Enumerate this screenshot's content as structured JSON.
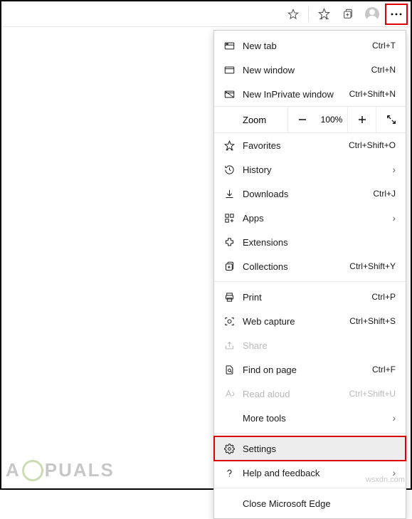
{
  "toolbar": {
    "star_icon": "star",
    "favorites_icon": "favorites",
    "collections_icon": "collections",
    "profile_icon": "profile",
    "more_icon": "more"
  },
  "menu": {
    "new_tab": {
      "label": "New tab",
      "shortcut": "Ctrl+T"
    },
    "new_window": {
      "label": "New window",
      "shortcut": "Ctrl+N"
    },
    "new_inprivate": {
      "label": "New InPrivate window",
      "shortcut": "Ctrl+Shift+N"
    },
    "zoom": {
      "label": "Zoom",
      "value": "100%"
    },
    "favorites": {
      "label": "Favorites",
      "shortcut": "Ctrl+Shift+O"
    },
    "history": {
      "label": "History"
    },
    "downloads": {
      "label": "Downloads",
      "shortcut": "Ctrl+J"
    },
    "apps": {
      "label": "Apps"
    },
    "extensions": {
      "label": "Extensions"
    },
    "collections": {
      "label": "Collections",
      "shortcut": "Ctrl+Shift+Y"
    },
    "print": {
      "label": "Print",
      "shortcut": "Ctrl+P"
    },
    "web_capture": {
      "label": "Web capture",
      "shortcut": "Ctrl+Shift+S"
    },
    "share": {
      "label": "Share"
    },
    "find": {
      "label": "Find on page",
      "shortcut": "Ctrl+F"
    },
    "read_aloud": {
      "label": "Read aloud",
      "shortcut": "Ctrl+Shift+U"
    },
    "more_tools": {
      "label": "More tools"
    },
    "settings": {
      "label": "Settings"
    },
    "help": {
      "label": "Help and feedback"
    },
    "close": {
      "label": "Close Microsoft Edge"
    }
  },
  "watermark": {
    "text": "A   PUALS",
    "domain": "wsxdn.com"
  }
}
